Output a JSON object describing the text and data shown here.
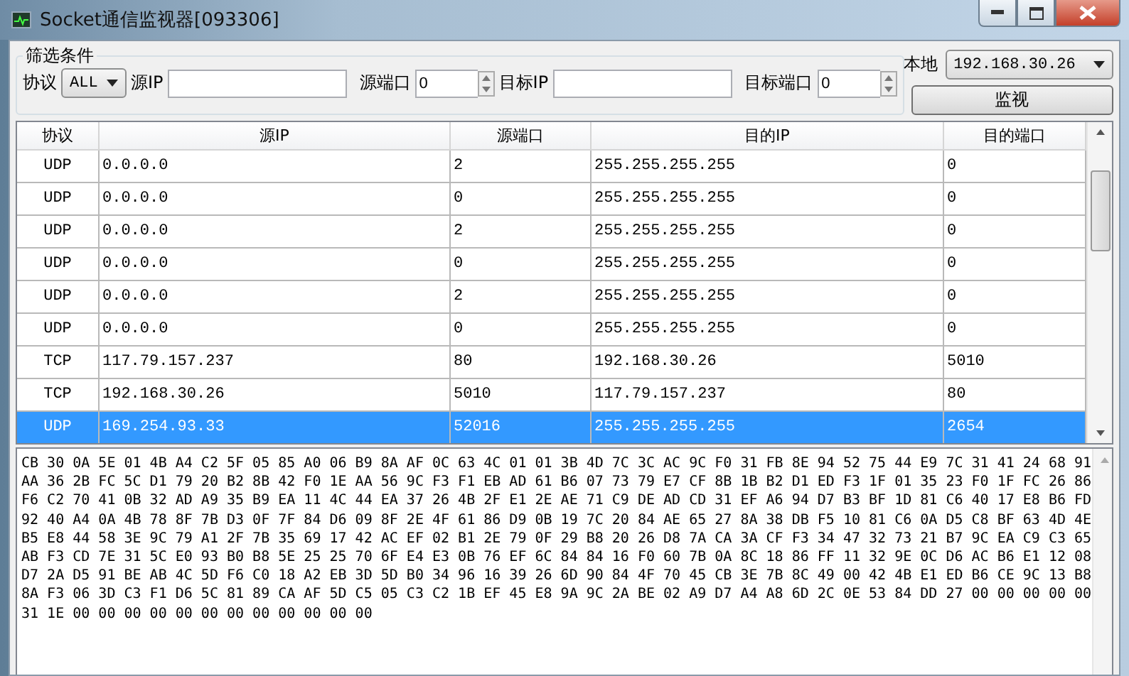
{
  "window": {
    "title": "Socket通信监视器[093306]"
  },
  "filter": {
    "title": "筛选条件",
    "protocol_label": "协议",
    "protocol_value": "ALL",
    "src_ip_label": "源IP",
    "src_port_label": "源端口",
    "src_port_value": "0",
    "dst_ip_label": "目标IP",
    "dst_port_label": "目标端口",
    "dst_port_value": "0"
  },
  "local": {
    "label": "本地",
    "value": "192.168.30.26",
    "button": "监视"
  },
  "table": {
    "columns": [
      "协议",
      "源IP",
      "源端口",
      "目的IP",
      "目的端口"
    ],
    "rows": [
      {
        "cells": [
          "UDP",
          "0.0.0.0",
          "2",
          "255.255.255.255",
          "0"
        ],
        "selected": false
      },
      {
        "cells": [
          "UDP",
          "0.0.0.0",
          "0",
          "255.255.255.255",
          "0"
        ],
        "selected": false
      },
      {
        "cells": [
          "UDP",
          "0.0.0.0",
          "2",
          "255.255.255.255",
          "0"
        ],
        "selected": false
      },
      {
        "cells": [
          "UDP",
          "0.0.0.0",
          "0",
          "255.255.255.255",
          "0"
        ],
        "selected": false
      },
      {
        "cells": [
          "UDP",
          "0.0.0.0",
          "2",
          "255.255.255.255",
          "0"
        ],
        "selected": false
      },
      {
        "cells": [
          "UDP",
          "0.0.0.0",
          "0",
          "255.255.255.255",
          "0"
        ],
        "selected": false
      },
      {
        "cells": [
          "TCP",
          "117.79.157.237",
          "80",
          "192.168.30.26",
          "5010"
        ],
        "selected": false
      },
      {
        "cells": [
          "TCP",
          "192.168.30.26",
          "5010",
          "117.79.157.237",
          "80"
        ],
        "selected": false
      },
      {
        "cells": [
          "UDP",
          "169.254.93.33",
          "52016",
          "255.255.255.255",
          "2654"
        ],
        "selected": true
      }
    ]
  },
  "hex_lines": [
    "CB 30 0A 5E 01 4B A4 C2 5F 05 85 A0 06 B9 8A AF 0C 63 4C 01 01 3B 4D 7C 3C AC 9C F0 31 FB 8E 94 52 75 44 E9 7C 31 41 24 68 91",
    "AA 36 2B FC 5C D1 79 20 B2 8B 42 F0 1E AA 56 9C F3 F1 EB AD 61 B6 07 73 79 E7 CF 8B 1B B2 D1 ED F3 1F 01 35 23 F0 1F FC 26 86",
    "F6 C2 70 41 0B 32 AD A9 35 B9 EA 11 4C 44 EA 37 26 4B 2F E1 2E AE 71 C9 DE AD CD 31 EF A6 94 D7 B3 BF 1D 81 C6 40 17 E8 B6 FD",
    "92 40 A4 0A 4B 78 8F 7B D3 0F 7F 84 D6 09 8F 2E 4F 61 86 D9 0B 19 7C 20 84 AE 65 27 8A 38 DB F5 10 81 C6 0A D5 C8 BF 63 4D 4E",
    "B5 E8 44 58 3E 9C 79 A1 2F 7B 35 69 17 42 AC EF 02 B1 2E 79 0F 29 B8 20 26 D8 7A CA 3A CF F3 34 47 32 73 21 B7 9C EA C9 C3 65",
    "AB F3 CD 7E 31 5C E0 93 B0 B8 5E 25 25 70 6F E4 E3 0B 76 EF 6C 84 84 16 F0 60 7B 0A 8C 18 86 FF 11 32 9E 0C D6 AC B6 E1 12 08",
    "D7 2A D5 91 BE AB 4C 5D F6 C0 18 A2 EB 3D 5D B0 34 96 16 39 26 6D 90 84 4F 70 45 CB 3E 7B 8C 49 00 42 4B E1 ED B6 CE 9C 13 B8",
    "8A F3 06 3D C3 F1 D6 5C 81 89 CA AF 5D C5 05 C3 C2 1B EF 45 E8 9A 9C 2A BE 02 A9 D7 A4 A8 6D 2C 0E 53 84 DD 27 00 00 00 00 00",
    "31 1E 00 00 00 00 00 00 00 00 00 00 00 00"
  ]
}
